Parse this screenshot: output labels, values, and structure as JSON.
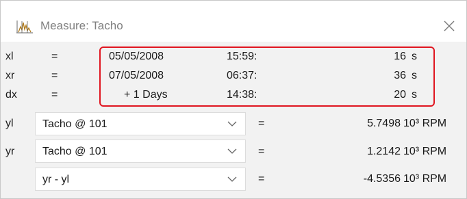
{
  "window": {
    "title": "Measure: Tacho",
    "icon": "measure-chart-icon",
    "close_icon": "close-icon"
  },
  "highlight_color": "#e0141f",
  "time_rows": [
    {
      "label": "xl",
      "eq": "=",
      "date": "05/05/2008",
      "time": "15:59:",
      "seconds": "16",
      "unit": "s"
    },
    {
      "label": "xr",
      "eq": "=",
      "date": "07/05/2008",
      "time": "06:37:",
      "seconds": "36",
      "unit": "s"
    },
    {
      "label": "dx",
      "eq": "=",
      "date": "+ 1 Days",
      "time": "14:38:",
      "seconds": "20",
      "unit": "s"
    }
  ],
  "value_rows": [
    {
      "label": "yl",
      "channel": "Tacho @ 101",
      "eq": "=",
      "value": "5.7498",
      "unit": "10³ RPM"
    },
    {
      "label": "yr",
      "channel": "Tacho @ 101",
      "eq": "=",
      "value": "1.2142",
      "unit": "10³ RPM"
    },
    {
      "label": "",
      "channel": "yr - yl",
      "eq": "=",
      "value": "-4.5356",
      "unit": "10³ RPM"
    }
  ]
}
